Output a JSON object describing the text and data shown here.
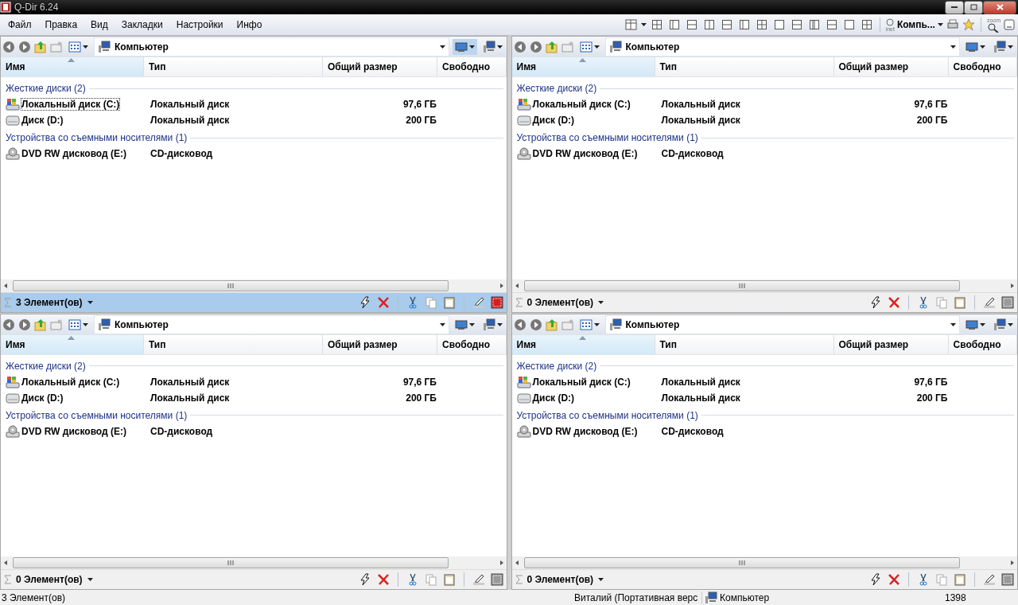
{
  "window": {
    "title": "Q-Dir 6.24"
  },
  "menu": [
    "Файл",
    "Правка",
    "Вид",
    "Закладки",
    "Настройки",
    "Инфо"
  ],
  "toolbar": {
    "inet_label": "inet",
    "location": "Компь...",
    "zoom_label": "zoom"
  },
  "panes": [
    {
      "active": true,
      "address": "Компьютер",
      "columns": [
        {
          "label": "Имя",
          "sorted": true
        },
        {
          "label": "Тип",
          "sorted": false
        },
        {
          "label": "Общий размер",
          "sorted": false
        },
        {
          "label": "Свободно",
          "sorted": false
        }
      ],
      "groups": [
        {
          "label": "Жесткие диски (2)",
          "items": [
            {
              "kind": "system",
              "name": "Локальный диск (C:)",
              "type": "Локальный диск",
              "size": "97,6 ГБ",
              "focused": true
            },
            {
              "kind": "disk",
              "name": "Диск (D:)",
              "type": "Локальный диск",
              "size": "200 ГБ",
              "focused": false
            }
          ]
        },
        {
          "label": "Устройства со съемными носителями (1)",
          "items": [
            {
              "kind": "dvd",
              "name": "DVD RW дисковод (E:)",
              "type": "CD-дисковод",
              "focused": false
            }
          ]
        }
      ],
      "count": "3 Элемент(ов)"
    },
    {
      "active": false,
      "address": "Компьютер",
      "columns": [
        {
          "label": "Имя",
          "sorted": true
        },
        {
          "label": "Тип",
          "sorted": false
        },
        {
          "label": "Общий размер",
          "sorted": false
        },
        {
          "label": "Свободно",
          "sorted": false
        }
      ],
      "groups": [
        {
          "label": "Жесткие диски (2)",
          "items": [
            {
              "kind": "system",
              "name": "Локальный диск (C:)",
              "type": "Локальный диск",
              "size": "97,6 ГБ",
              "focused": false
            },
            {
              "kind": "disk",
              "name": "Диск (D:)",
              "type": "Локальный диск",
              "size": "200 ГБ",
              "focused": false
            }
          ]
        },
        {
          "label": "Устройства со съемными носителями (1)",
          "items": [
            {
              "kind": "dvd",
              "name": "DVD RW дисковод (E:)",
              "type": "CD-дисковод",
              "focused": false
            }
          ]
        }
      ],
      "count": "0 Элемент(ов)"
    },
    {
      "active": false,
      "address": "Компьютер",
      "columns": [
        {
          "label": "Имя",
          "sorted": true
        },
        {
          "label": "Тип",
          "sorted": false
        },
        {
          "label": "Общий размер",
          "sorted": false
        },
        {
          "label": "Свободно",
          "sorted": false
        }
      ],
      "groups": [
        {
          "label": "Жесткие диски (2)",
          "items": [
            {
              "kind": "system",
              "name": "Локальный диск (C:)",
              "type": "Локальный диск",
              "size": "97,6 ГБ",
              "focused": false
            },
            {
              "kind": "disk",
              "name": "Диск (D:)",
              "type": "Локальный диск",
              "size": "200 ГБ",
              "focused": false
            }
          ]
        },
        {
          "label": "Устройства со съемными носителями (1)",
          "items": [
            {
              "kind": "dvd",
              "name": "DVD RW дисковод (E:)",
              "type": "CD-дисковод",
              "focused": false
            }
          ]
        }
      ],
      "count": "0 Элемент(ов)"
    },
    {
      "active": false,
      "address": "Компьютер",
      "columns": [
        {
          "label": "Имя",
          "sorted": true
        },
        {
          "label": "Тип",
          "sorted": false
        },
        {
          "label": "Общий размер",
          "sorted": false
        },
        {
          "label": "Свободно",
          "sorted": false
        }
      ],
      "groups": [
        {
          "label": "Жесткие диски (2)",
          "items": [
            {
              "kind": "system",
              "name": "Локальный диск (C:)",
              "type": "Локальный диск",
              "size": "97,6 ГБ",
              "focused": false
            },
            {
              "kind": "disk",
              "name": "Диск (D:)",
              "type": "Локальный диск",
              "size": "200 ГБ",
              "focused": false
            }
          ]
        },
        {
          "label": "Устройства со съемными носителями (1)",
          "items": [
            {
              "kind": "dvd",
              "name": "DVD RW дисковод (E:)",
              "type": "CD-дисковод",
              "focused": false
            }
          ]
        }
      ],
      "count": "0 Элемент(ов)"
    }
  ],
  "status_bar": {
    "summary": "3 Элемент(ов)",
    "user": "Виталий (Портативная верс",
    "location": "Компьютер",
    "number": "1398"
  }
}
